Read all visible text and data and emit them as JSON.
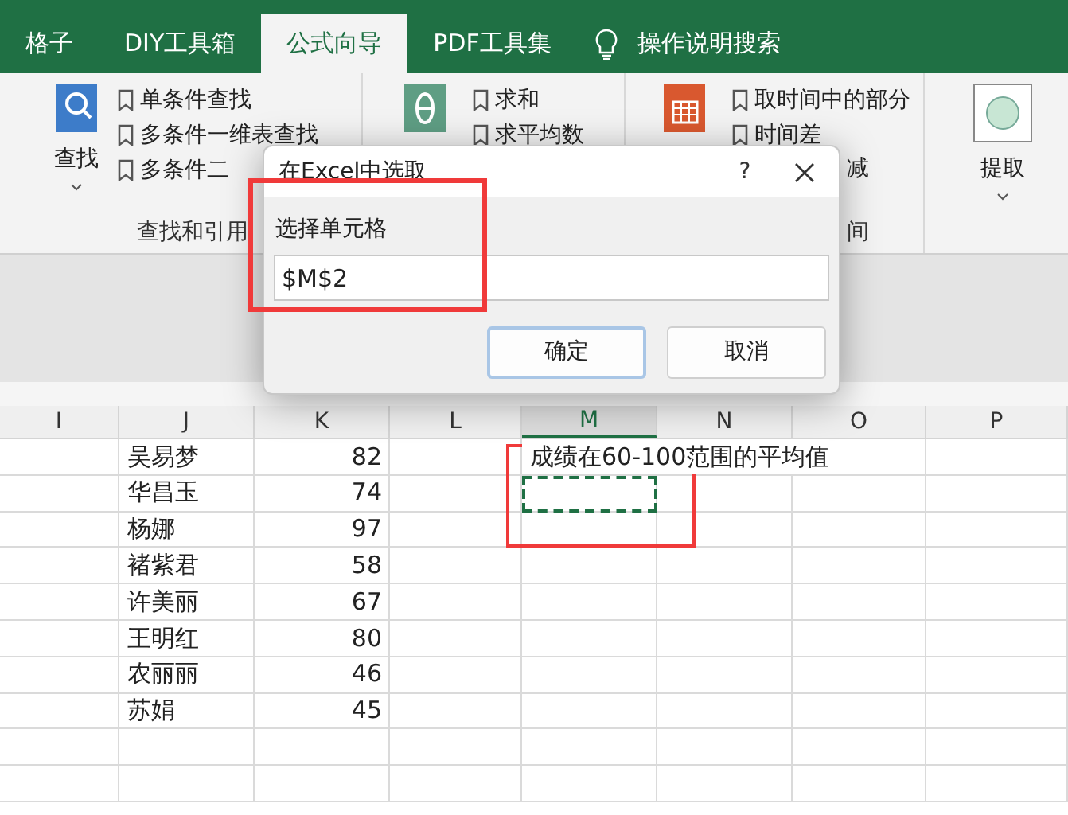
{
  "tabs": [
    {
      "label": "格子",
      "selected": false
    },
    {
      "label": "DIY工具箱",
      "selected": false
    },
    {
      "label": "公式向导",
      "selected": true
    },
    {
      "label": "PDF工具集",
      "selected": false
    }
  ],
  "search": {
    "label": "操作说明搜索"
  },
  "ribbon": {
    "lookup": {
      "label": "查找",
      "items": [
        "单条件查找",
        "多条件一维表查找",
        "多条件二"
      ],
      "group_label": "查找和引用"
    },
    "math": {
      "items": [
        "求和",
        "求平均数"
      ]
    },
    "datetime": {
      "items": [
        "取时间中的部分",
        "时间差",
        "减"
      ],
      "group_label": "间"
    },
    "extract": {
      "label": "提取"
    }
  },
  "dialog": {
    "title": "在Excel中选取",
    "help": "?",
    "field_label": "选择单元格",
    "value": "$M$2",
    "buttons": [
      "确定",
      "取消"
    ]
  },
  "sheet": {
    "columns": [
      {
        "label": "I",
        "selected": false
      },
      {
        "label": "J",
        "selected": false
      },
      {
        "label": "K",
        "selected": false
      },
      {
        "label": "L",
        "selected": false
      },
      {
        "label": "M",
        "selected": true
      },
      {
        "label": "N",
        "selected": false
      },
      {
        "label": "O",
        "selected": false
      },
      {
        "label": "P",
        "selected": false
      }
    ],
    "rows": [
      {
        "name": "吴易梦",
        "score": "82",
        "note": "成绩在60-100范围的平均值"
      },
      {
        "name": "华昌玉",
        "score": "74"
      },
      {
        "name": "杨娜",
        "score": "97"
      },
      {
        "name": "褚紫君",
        "score": "58"
      },
      {
        "name": "许美丽",
        "score": "67"
      },
      {
        "name": "王明红",
        "score": "80"
      },
      {
        "name": "农丽丽",
        "score": "46"
      },
      {
        "name": "苏娟",
        "score": "45"
      }
    ]
  }
}
